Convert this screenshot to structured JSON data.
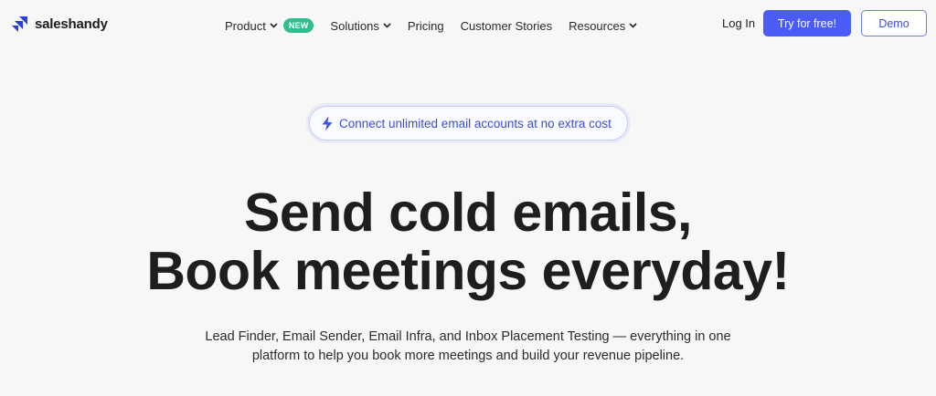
{
  "brand": {
    "name": "saleshandy",
    "accent_color": "#4a5cf5"
  },
  "nav": {
    "items": [
      {
        "label": "Product",
        "has_dropdown": true,
        "badge": "NEW"
      },
      {
        "label": "Solutions",
        "has_dropdown": true
      },
      {
        "label": "Pricing",
        "has_dropdown": false
      },
      {
        "label": "Customer Stories",
        "has_dropdown": false
      },
      {
        "label": "Resources",
        "has_dropdown": true
      }
    ],
    "login_label": "Log In",
    "try_label": "Try for free!",
    "demo_label": "Demo"
  },
  "hero": {
    "pill_text": "Connect unlimited email accounts at no extra cost",
    "pill_icon": "lightning-icon",
    "headline_line1": "Send cold emails,",
    "headline_line2": "Book meetings everyday!",
    "sub_line1": "Lead Finder, Email Sender, Email Infra, and Inbox Placement Testing — everything in one",
    "sub_line2": "platform to help you book more meetings and build your revenue pipeline."
  }
}
